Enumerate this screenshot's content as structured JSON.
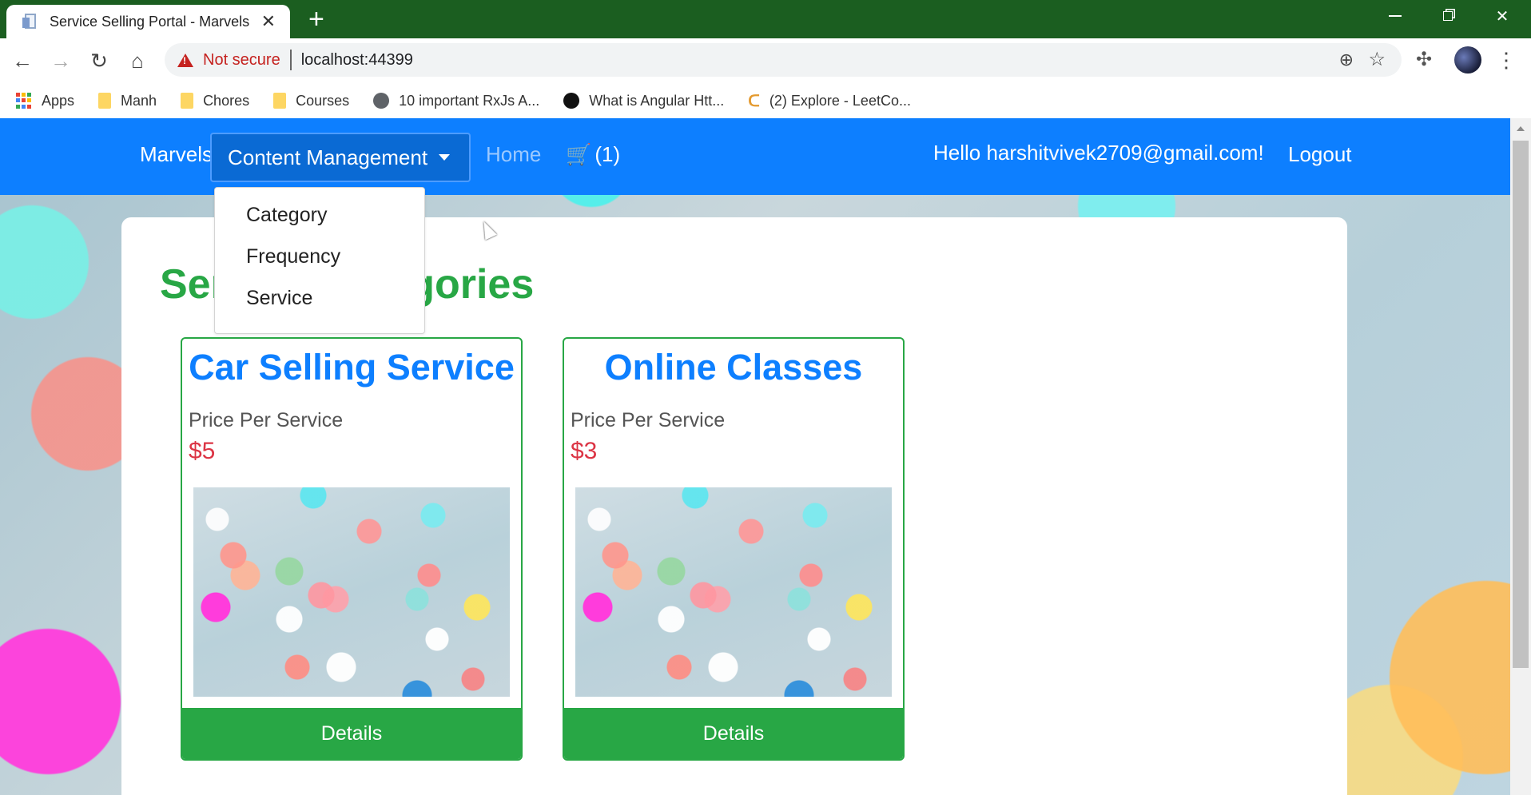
{
  "browser": {
    "tab_title": "Service Selling Portal - Marvels",
    "tab_close": "✕",
    "new_tab": "+",
    "security_label": "Not secure",
    "url": "localhost:44399",
    "bookmarks": [
      {
        "label": "Apps",
        "icon": "apps-grid-icon"
      },
      {
        "label": "Manh",
        "icon": "folder-icon"
      },
      {
        "label": "Chores",
        "icon": "folder-icon"
      },
      {
        "label": "Courses",
        "icon": "folder-icon"
      },
      {
        "label": "10 important RxJs A...",
        "icon": "globe-icon"
      },
      {
        "label": "What is Angular Htt...",
        "icon": "stackchief-icon"
      },
      {
        "label": "(2) Explore - LeetCo...",
        "icon": "leetcode-icon"
      }
    ]
  },
  "navbar": {
    "brand": "Marvels",
    "dropdown_label": "Content Management",
    "home": "Home",
    "cart_count": "(1)",
    "greeting": "Hello harshitvivek2709@gmail.com!",
    "logout": "Logout",
    "color": "#0d7fff"
  },
  "dropdown": {
    "items": [
      "Category",
      "Frequency",
      "Service"
    ]
  },
  "main": {
    "heading": "Service Categories",
    "cards": [
      {
        "title": "Car Selling Service",
        "price_label": "Price Per Service",
        "price": "$5",
        "button": "Details"
      },
      {
        "title": "Online Classes",
        "price_label": "Price Per Service",
        "price": "$3",
        "button": "Details"
      }
    ]
  }
}
